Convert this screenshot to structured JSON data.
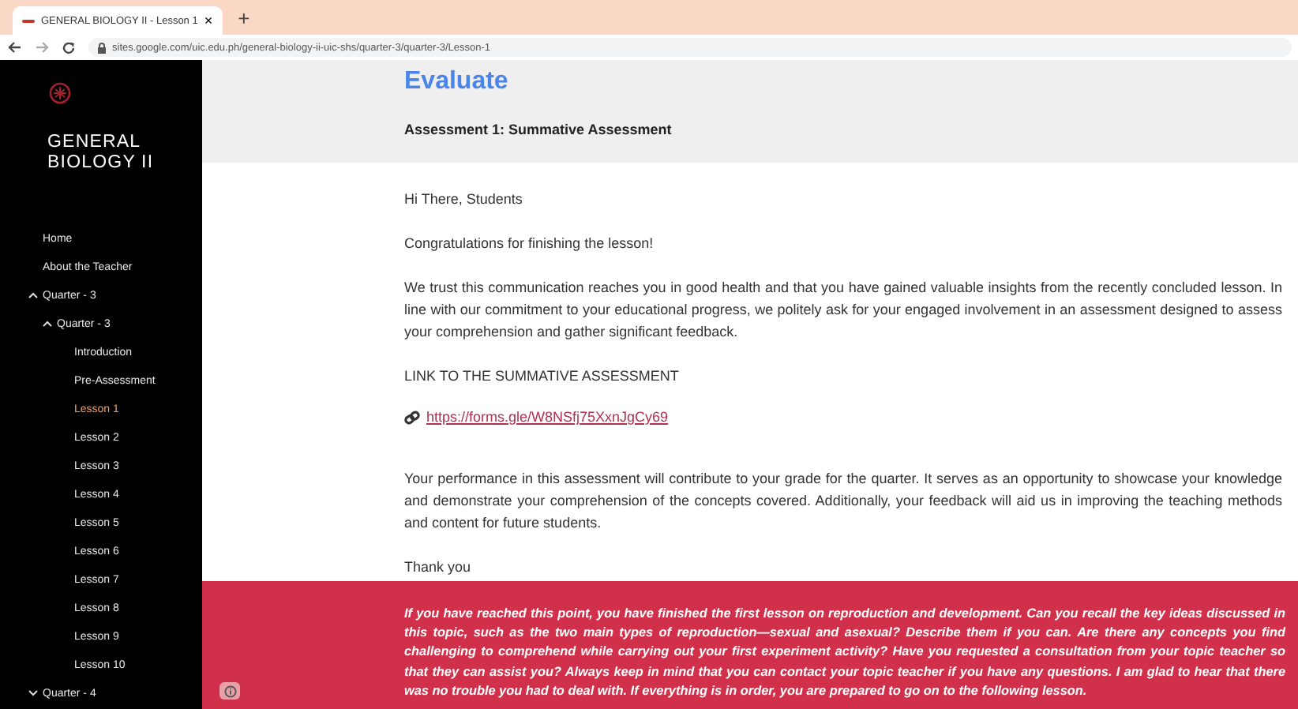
{
  "browser": {
    "tab_title": "GENERAL BIOLOGY II - Lesson 1",
    "tab_close": "×",
    "new_tab": "+",
    "url": "sites.google.com/uic.edu.ph/general-biology-ii-uic-shs/quarter-3/quarter-3/Lesson-1"
  },
  "sidebar": {
    "site_title": "GENERAL BIOLOGY II",
    "items": [
      {
        "label": "Home",
        "selected": false
      },
      {
        "label": "About the Teacher",
        "selected": false
      },
      {
        "label": "Quarter - 3",
        "selected": false,
        "expanded": true,
        "children": [
          {
            "label": "Quarter - 3",
            "selected": false,
            "expanded": true,
            "children": [
              {
                "label": "Introduction",
                "selected": false
              },
              {
                "label": "Pre-Assessment",
                "selected": false
              },
              {
                "label": "Lesson 1",
                "selected": true
              },
              {
                "label": "Lesson 2",
                "selected": false
              },
              {
                "label": "Lesson 3",
                "selected": false
              },
              {
                "label": "Lesson 4",
                "selected": false
              },
              {
                "label": "Lesson 5",
                "selected": false
              },
              {
                "label": "Lesson 6",
                "selected": false
              },
              {
                "label": "Lesson 7",
                "selected": false
              },
              {
                "label": "Lesson 8",
                "selected": false
              },
              {
                "label": "Lesson 9",
                "selected": false
              },
              {
                "label": "Lesson 10",
                "selected": false
              }
            ]
          }
        ]
      },
      {
        "label": "Quarter - 4",
        "selected": false,
        "expanded": false
      }
    ]
  },
  "main": {
    "title": "Evaluate",
    "subtitle": "Assessment 1: Summative Assessment",
    "blocks": [
      {
        "kind": "text",
        "text": "Hi There, Students"
      },
      {
        "kind": "text",
        "text": "Congratulations for finishing the lesson!"
      },
      {
        "kind": "text",
        "text": "We trust this communication reaches you in good health and that you have gained valuable insights from the recently concluded lesson. In line with our commitment to your educational progress, we politely ask for your engaged involvement in an assessment designed to assess your comprehension and gather significant feedback."
      },
      {
        "kind": "text",
        "text": "LINK TO THE SUMMATIVE ASSESSMENT"
      },
      {
        "kind": "link",
        "text": "https://forms.gle/W8NSfj75XxnJgCy69"
      },
      {
        "kind": "text",
        "text": "Your performance in this assessment will contribute to your grade for the quarter. It serves as an opportunity to showcase your knowledge and demonstrate your comprehension of the concepts covered. Additionally, your feedback will aid us in improving the teaching methods and content for future students."
      },
      {
        "kind": "text",
        "text": "Thank you"
      }
    ],
    "callout": "If you have reached this point, you have finished the first lesson on reproduction and development. Can you recall the key ideas discussed in this topic, such as the two main types of reproduction—sexual and asexual? Describe them if you can. Are there any concepts you find challenging to comprehend while carrying out your first experiment activity? Have you requested a consultation from your topic teacher so that they can assist you? Always keep in mind that you can contact your topic teacher if you have any questions. I am glad to hear that there was no trouble you had to deal with. If everything is in order, you are prepared to go on to the following lesson."
  }
}
